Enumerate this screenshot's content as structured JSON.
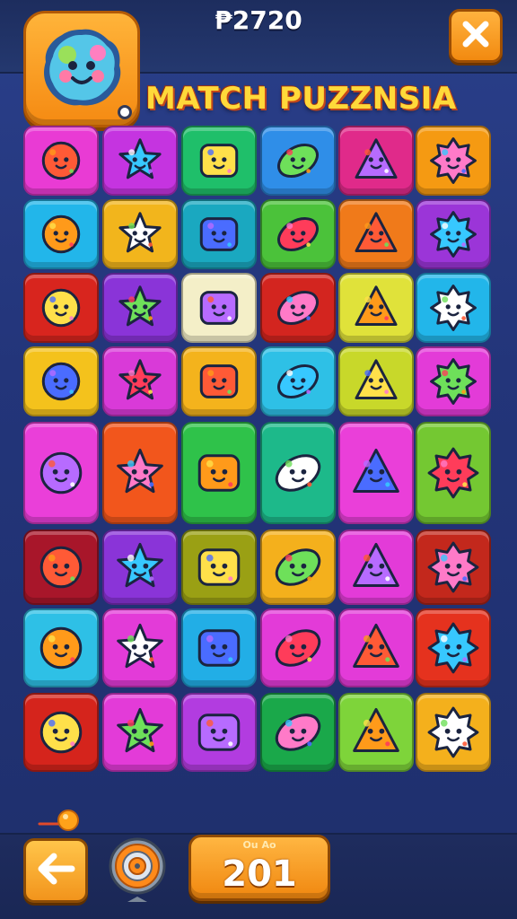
{
  "header": {
    "score_text": "₱2720",
    "title": "MATCH PUZZNSIA",
    "avatar_icon": "blob-face-icon",
    "close_icon": "close-icon"
  },
  "board": {
    "rows": [
      [
        {
          "icon": "purple-blob-icon",
          "bg": "#e93bd4"
        },
        {
          "icon": "star-face-icon",
          "bg": "#c534e0"
        },
        {
          "icon": "hat-icon",
          "bg": "#1fbf6a"
        },
        {
          "icon": "rocket-icon",
          "bg": "#2f8ee8"
        },
        {
          "icon": "bunny-icon",
          "bg": "#e02a8a"
        },
        {
          "icon": "sun-icon",
          "bg": "#f59a12"
        }
      ],
      [
        {
          "icon": "plane-icon",
          "bg": "#22b6ea"
        },
        {
          "icon": "pinwheel-icon",
          "bg": "#f2b51c"
        },
        {
          "icon": "ring-icon",
          "bg": "#1aa8c0"
        },
        {
          "icon": "bell-face-icon",
          "bg": "#4bc23a"
        },
        {
          "icon": "bear-icon",
          "bg": "#f07a1a"
        },
        {
          "icon": "red-sun-icon",
          "bg": "#9b35d8"
        }
      ],
      [
        {
          "icon": "tool-icon",
          "bg": "#d8251e"
        },
        {
          "icon": "fish-icon",
          "bg": "#8a34d8"
        },
        {
          "icon": "virus-icon",
          "bg": "#f4efc8"
        },
        {
          "icon": "gear-icon",
          "bg": "#d3251f"
        },
        {
          "icon": "bubble-icon",
          "bg": "#e0e23a"
        },
        {
          "icon": "cloud-icon",
          "bg": "#22b6ea"
        }
      ],
      [
        {
          "icon": "spiky-face-icon",
          "bg": "#f4c21c"
        },
        {
          "icon": "cat-face-icon",
          "bg": "#d93ad8"
        },
        {
          "icon": "water-drop-icon",
          "bg": "#f4b31c"
        },
        {
          "icon": "leaf-icon",
          "bg": "#2ec0e6"
        },
        {
          "icon": "candy-icon",
          "bg": "#c8d82a"
        },
        {
          "icon": "sofa-icon",
          "bg": "#e33bd8"
        }
      ],
      [
        {
          "icon": "cabinet-icon",
          "bg": "#ea3fd9"
        },
        {
          "icon": "dino-icon",
          "bg": "#f2561c"
        },
        {
          "icon": "bulb-icon",
          "bg": "#2fc24a"
        },
        {
          "icon": "machine-icon",
          "bg": "#1db98a"
        },
        {
          "icon": "monster-icon",
          "bg": "#ea3fd9"
        },
        {
          "icon": "dragon-icon",
          "bg": "#74c832"
        }
      ],
      [
        {
          "icon": "candy-wrap-icon",
          "bg": "#a8162a"
        },
        {
          "icon": "chat-face-icon",
          "bg": "#8a34d8"
        },
        {
          "icon": "red-star-burst-icon",
          "bg": "#9aa014"
        },
        {
          "icon": "flower-icon",
          "bg": "#f4b01c"
        },
        {
          "icon": "blue-fish-icon",
          "bg": "#e33bd8"
        },
        {
          "icon": "robot-face-icon",
          "bg": "#c3281c"
        }
      ],
      [
        {
          "icon": "dog-icon",
          "bg": "#2ec0e6"
        },
        {
          "icon": "green-face-icon",
          "bg": "#e33bd8"
        },
        {
          "icon": "rocket-red-icon",
          "bg": "#22aee6"
        },
        {
          "icon": "blue-virus-icon",
          "bg": "#e33bd8"
        },
        {
          "icon": "pencil-icon",
          "bg": "#e33bd8"
        },
        {
          "icon": "green-cross-icon",
          "bg": "#e5321e"
        }
      ],
      [
        {
          "icon": "cog-icon",
          "bg": "#d5241c"
        },
        {
          "icon": "blue-bubble-icon",
          "bg": "#e33bd8"
        },
        {
          "icon": "orange-leaf-icon",
          "bg": "#b23ce0"
        },
        {
          "icon": "orange-ball-icon",
          "bg": "#1aa84a"
        },
        {
          "icon": "jar-icon",
          "bg": "#7ed43a"
        },
        {
          "icon": "green-fish-icon",
          "bg": "#f4b01c"
        }
      ]
    ]
  },
  "footer": {
    "back_icon": "arrow-left-icon",
    "target_icon": "target-icon",
    "moves_value": "201",
    "moves_deco": "Ou Ao",
    "marker_icon": "orange-dot-icon"
  }
}
